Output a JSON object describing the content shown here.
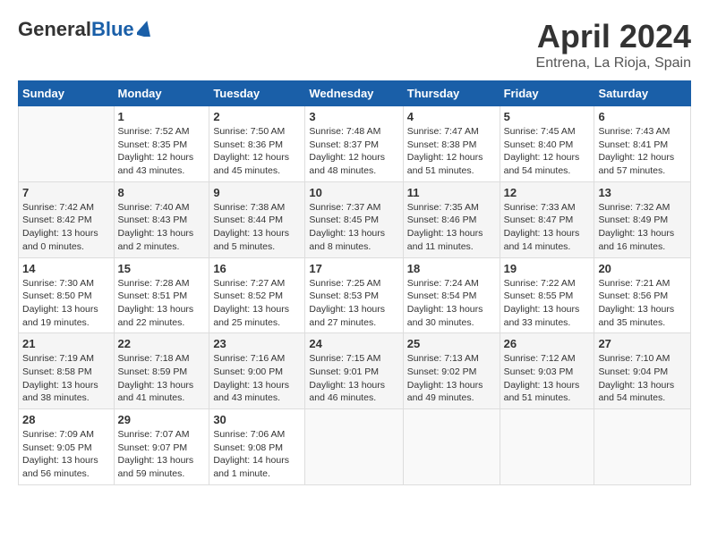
{
  "header": {
    "logo_general": "General",
    "logo_blue": "Blue",
    "month_title": "April 2024",
    "location": "Entrena, La Rioja, Spain"
  },
  "days_of_week": [
    "Sunday",
    "Monday",
    "Tuesday",
    "Wednesday",
    "Thursday",
    "Friday",
    "Saturday"
  ],
  "weeks": [
    [
      {
        "day": "",
        "sunrise": "",
        "sunset": "",
        "daylight": ""
      },
      {
        "day": "1",
        "sunrise": "Sunrise: 7:52 AM",
        "sunset": "Sunset: 8:35 PM",
        "daylight": "Daylight: 12 hours and 43 minutes."
      },
      {
        "day": "2",
        "sunrise": "Sunrise: 7:50 AM",
        "sunset": "Sunset: 8:36 PM",
        "daylight": "Daylight: 12 hours and 45 minutes."
      },
      {
        "day": "3",
        "sunrise": "Sunrise: 7:48 AM",
        "sunset": "Sunset: 8:37 PM",
        "daylight": "Daylight: 12 hours and 48 minutes."
      },
      {
        "day": "4",
        "sunrise": "Sunrise: 7:47 AM",
        "sunset": "Sunset: 8:38 PM",
        "daylight": "Daylight: 12 hours and 51 minutes."
      },
      {
        "day": "5",
        "sunrise": "Sunrise: 7:45 AM",
        "sunset": "Sunset: 8:40 PM",
        "daylight": "Daylight: 12 hours and 54 minutes."
      },
      {
        "day": "6",
        "sunrise": "Sunrise: 7:43 AM",
        "sunset": "Sunset: 8:41 PM",
        "daylight": "Daylight: 12 hours and 57 minutes."
      }
    ],
    [
      {
        "day": "7",
        "sunrise": "Sunrise: 7:42 AM",
        "sunset": "Sunset: 8:42 PM",
        "daylight": "Daylight: 13 hours and 0 minutes."
      },
      {
        "day": "8",
        "sunrise": "Sunrise: 7:40 AM",
        "sunset": "Sunset: 8:43 PM",
        "daylight": "Daylight: 13 hours and 2 minutes."
      },
      {
        "day": "9",
        "sunrise": "Sunrise: 7:38 AM",
        "sunset": "Sunset: 8:44 PM",
        "daylight": "Daylight: 13 hours and 5 minutes."
      },
      {
        "day": "10",
        "sunrise": "Sunrise: 7:37 AM",
        "sunset": "Sunset: 8:45 PM",
        "daylight": "Daylight: 13 hours and 8 minutes."
      },
      {
        "day": "11",
        "sunrise": "Sunrise: 7:35 AM",
        "sunset": "Sunset: 8:46 PM",
        "daylight": "Daylight: 13 hours and 11 minutes."
      },
      {
        "day": "12",
        "sunrise": "Sunrise: 7:33 AM",
        "sunset": "Sunset: 8:47 PM",
        "daylight": "Daylight: 13 hours and 14 minutes."
      },
      {
        "day": "13",
        "sunrise": "Sunrise: 7:32 AM",
        "sunset": "Sunset: 8:49 PM",
        "daylight": "Daylight: 13 hours and 16 minutes."
      }
    ],
    [
      {
        "day": "14",
        "sunrise": "Sunrise: 7:30 AM",
        "sunset": "Sunset: 8:50 PM",
        "daylight": "Daylight: 13 hours and 19 minutes."
      },
      {
        "day": "15",
        "sunrise": "Sunrise: 7:28 AM",
        "sunset": "Sunset: 8:51 PM",
        "daylight": "Daylight: 13 hours and 22 minutes."
      },
      {
        "day": "16",
        "sunrise": "Sunrise: 7:27 AM",
        "sunset": "Sunset: 8:52 PM",
        "daylight": "Daylight: 13 hours and 25 minutes."
      },
      {
        "day": "17",
        "sunrise": "Sunrise: 7:25 AM",
        "sunset": "Sunset: 8:53 PM",
        "daylight": "Daylight: 13 hours and 27 minutes."
      },
      {
        "day": "18",
        "sunrise": "Sunrise: 7:24 AM",
        "sunset": "Sunset: 8:54 PM",
        "daylight": "Daylight: 13 hours and 30 minutes."
      },
      {
        "day": "19",
        "sunrise": "Sunrise: 7:22 AM",
        "sunset": "Sunset: 8:55 PM",
        "daylight": "Daylight: 13 hours and 33 minutes."
      },
      {
        "day": "20",
        "sunrise": "Sunrise: 7:21 AM",
        "sunset": "Sunset: 8:56 PM",
        "daylight": "Daylight: 13 hours and 35 minutes."
      }
    ],
    [
      {
        "day": "21",
        "sunrise": "Sunrise: 7:19 AM",
        "sunset": "Sunset: 8:58 PM",
        "daylight": "Daylight: 13 hours and 38 minutes."
      },
      {
        "day": "22",
        "sunrise": "Sunrise: 7:18 AM",
        "sunset": "Sunset: 8:59 PM",
        "daylight": "Daylight: 13 hours and 41 minutes."
      },
      {
        "day": "23",
        "sunrise": "Sunrise: 7:16 AM",
        "sunset": "Sunset: 9:00 PM",
        "daylight": "Daylight: 13 hours and 43 minutes."
      },
      {
        "day": "24",
        "sunrise": "Sunrise: 7:15 AM",
        "sunset": "Sunset: 9:01 PM",
        "daylight": "Daylight: 13 hours and 46 minutes."
      },
      {
        "day": "25",
        "sunrise": "Sunrise: 7:13 AM",
        "sunset": "Sunset: 9:02 PM",
        "daylight": "Daylight: 13 hours and 49 minutes."
      },
      {
        "day": "26",
        "sunrise": "Sunrise: 7:12 AM",
        "sunset": "Sunset: 9:03 PM",
        "daylight": "Daylight: 13 hours and 51 minutes."
      },
      {
        "day": "27",
        "sunrise": "Sunrise: 7:10 AM",
        "sunset": "Sunset: 9:04 PM",
        "daylight": "Daylight: 13 hours and 54 minutes."
      }
    ],
    [
      {
        "day": "28",
        "sunrise": "Sunrise: 7:09 AM",
        "sunset": "Sunset: 9:05 PM",
        "daylight": "Daylight: 13 hours and 56 minutes."
      },
      {
        "day": "29",
        "sunrise": "Sunrise: 7:07 AM",
        "sunset": "Sunset: 9:07 PM",
        "daylight": "Daylight: 13 hours and 59 minutes."
      },
      {
        "day": "30",
        "sunrise": "Sunrise: 7:06 AM",
        "sunset": "Sunset: 9:08 PM",
        "daylight": "Daylight: 14 hours and 1 minute."
      },
      {
        "day": "",
        "sunrise": "",
        "sunset": "",
        "daylight": ""
      },
      {
        "day": "",
        "sunrise": "",
        "sunset": "",
        "daylight": ""
      },
      {
        "day": "",
        "sunrise": "",
        "sunset": "",
        "daylight": ""
      },
      {
        "day": "",
        "sunrise": "",
        "sunset": "",
        "daylight": ""
      }
    ]
  ]
}
